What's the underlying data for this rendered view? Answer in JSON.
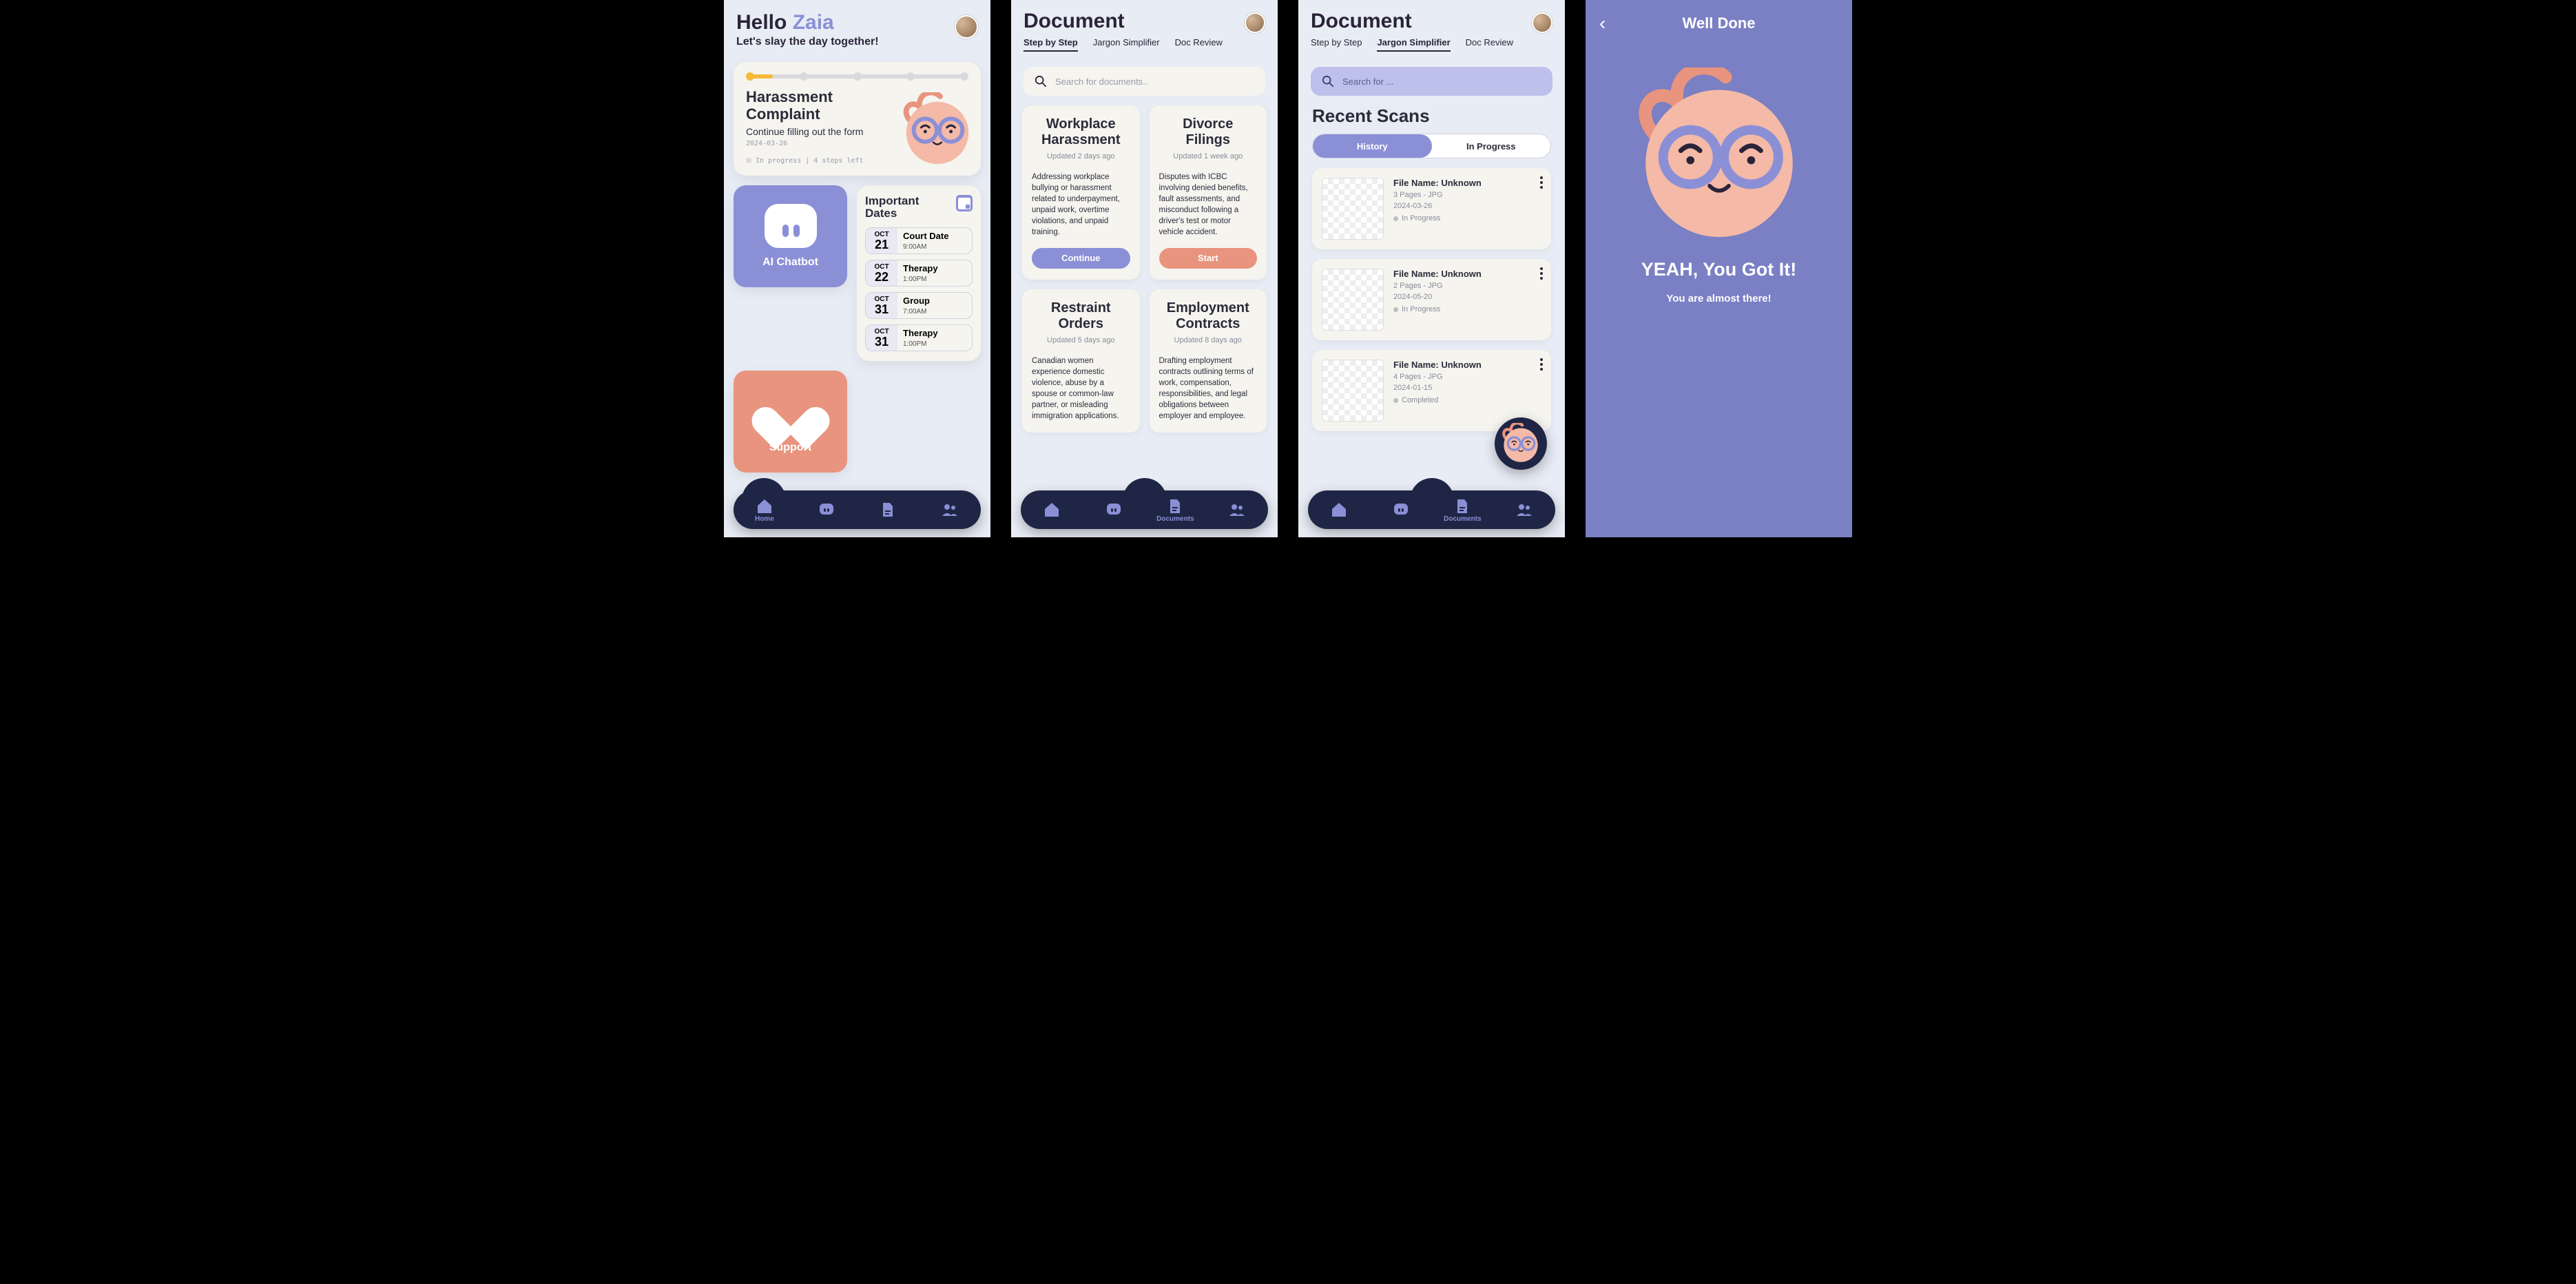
{
  "home": {
    "greeting_prefix": "Hello ",
    "user_name": "Zaia",
    "tagline": "Let's slay the day together!",
    "progress_card": {
      "title_l1": "Harassment",
      "title_l2": "Complaint",
      "subtitle": "Continue filling out the form",
      "date": "2024-03-26",
      "status_text": "In progress | 4 steps left"
    },
    "ai_chatbot_label": "AI Chatbot",
    "support_label": "Support",
    "important_dates_title": "Important Dates",
    "dates": [
      {
        "mon": "OCT",
        "day": "21",
        "title": "Court Date",
        "time": "9:00AM"
      },
      {
        "mon": "OCT",
        "day": "22",
        "title": "Therapy",
        "time": "1:00PM"
      },
      {
        "mon": "OCT",
        "day": "31",
        "title": "Group",
        "time": "7:00AM"
      },
      {
        "mon": "OCT",
        "day": "31",
        "title": "Therapy",
        "time": "1:00PM"
      }
    ],
    "nav": {
      "home": "Home",
      "documents": "Documents"
    }
  },
  "doc": {
    "title": "Document",
    "tabs": {
      "step": "Step by Step",
      "jargon": "Jargon Simplifier",
      "review": "Doc Review"
    },
    "search_placeholder": "Search for documents..",
    "cards": [
      {
        "title_l1": "Workplace",
        "title_l2": "Harassment",
        "updated": "Updated 2 days ago",
        "desc": "Addressing workplace bullying or harassment related to underpayment, unpaid work, overtime violations, and unpaid training.",
        "btn": "Continue"
      },
      {
        "title_l1": "Divorce",
        "title_l2": "Filings",
        "updated": "Updated 1 week ago",
        "desc": "Disputes with ICBC involving denied benefits, fault assessments, and misconduct following a driver's test or motor vehicle accident.",
        "btn": "Start"
      },
      {
        "title_l1": "Restraint",
        "title_l2": "Orders",
        "updated": "Updated 5 days ago",
        "desc": "Canadian women experience domestic violence, abuse by a spouse or common-law partner, or misleading immigration applications."
      },
      {
        "title_l1": "Employment",
        "title_l2": "Contracts",
        "updated": "Updated 8 days ago",
        "desc": "Drafting employment contracts outlining terms of work, compensation, responsibilities, and legal obligations between employer and employee."
      }
    ]
  },
  "jargon": {
    "search_placeholder": "Search for ...",
    "recent_title": "Recent Scans",
    "seg_history": "History",
    "seg_progress": "In Progress",
    "scans": [
      {
        "name": "File Name: Unknown",
        "meta": "3 Pages - JPG",
        "date": "2024-03-26",
        "status": "In Progress"
      },
      {
        "name": "File Name: Unknown",
        "meta": "2 Pages - JPG",
        "date": "2024-05-20",
        "status": "In Progress"
      },
      {
        "name": "File Name: Unknown",
        "meta": "4 Pages - JPG",
        "date": "2024-01-15",
        "status": "Completed"
      }
    ]
  },
  "done": {
    "header": "Well Done",
    "headline": "YEAH, You Got It!",
    "sub": "You are almost there!"
  }
}
